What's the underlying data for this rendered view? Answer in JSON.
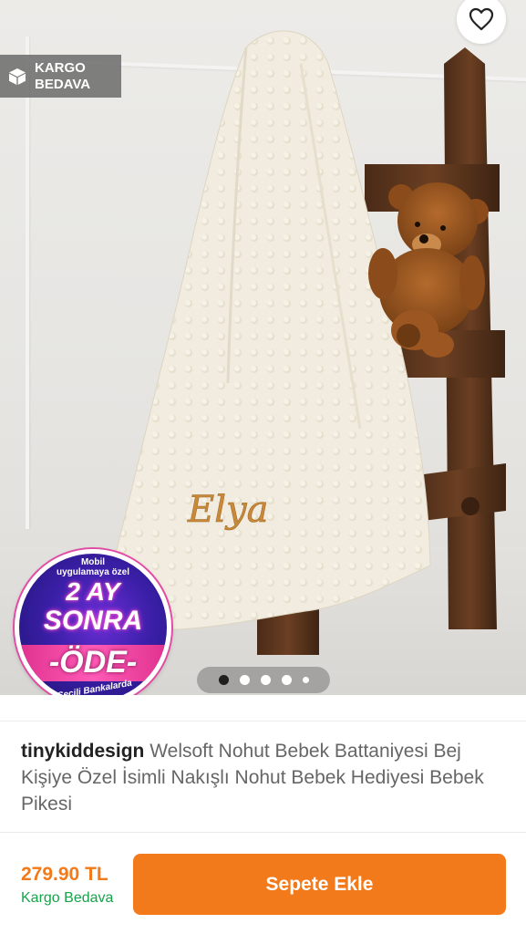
{
  "badge": {
    "line1": "KARGO",
    "line2": "BEDAVA",
    "icon": "box-icon"
  },
  "favorite": {
    "icon": "heart-icon"
  },
  "image": {
    "embroidery": "Elya"
  },
  "promo": {
    "line1": "Mobil",
    "line2": "uygulamaya özel",
    "big1": "2 AY",
    "big2": "SONRA",
    "big3": "-ÖDE-",
    "footnote": "*Seçili Bankalarda"
  },
  "pager": {
    "count": 5,
    "active_index": 0
  },
  "product": {
    "brand": "tinykiddesign",
    "name": "Welsoft Nohut Bebek Battaniyesi Bej Kişiye Özel İsimli Nakışlı Nohut Bebek Hediyesi Bebek Pikesi"
  },
  "bottom": {
    "price": "279.90 TL",
    "cargo": "Kargo Bedava",
    "cta": "Sepete Ekle"
  },
  "colors": {
    "accent": "#f27a1a",
    "free_shipping": "#16a34a"
  }
}
